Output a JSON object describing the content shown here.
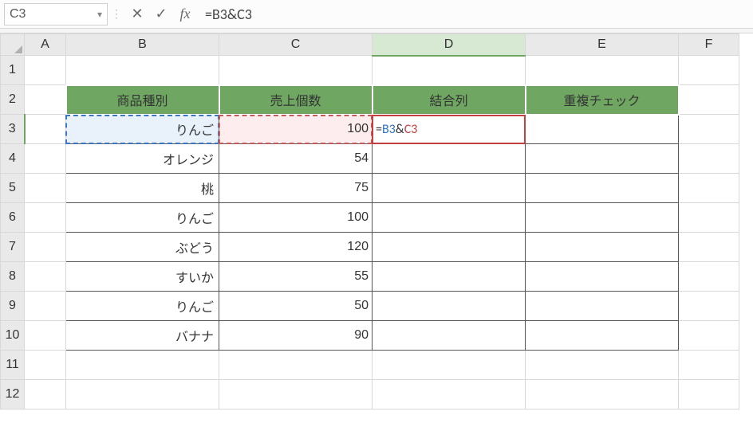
{
  "name_box": "C3",
  "formula_text": "=B3&C3",
  "columns": [
    "A",
    "B",
    "C",
    "D",
    "E",
    "F"
  ],
  "rows": [
    "1",
    "2",
    "3",
    "4",
    "5",
    "6",
    "7",
    "8",
    "9",
    "10",
    "11",
    "12"
  ],
  "headers": {
    "B": "商品種別",
    "C": "売上個数",
    "D": "結合列",
    "E": "重複チェック"
  },
  "data": [
    {
      "b": "りんご",
      "c": "100"
    },
    {
      "b": "オレンジ",
      "c": "54"
    },
    {
      "b": "桃",
      "c": "75"
    },
    {
      "b": "りんご",
      "c": "100"
    },
    {
      "b": "ぶどう",
      "c": "120"
    },
    {
      "b": "すいか",
      "c": "55"
    },
    {
      "b": "りんご",
      "c": "50"
    },
    {
      "b": "バナナ",
      "c": "90"
    }
  ],
  "editing_cell": {
    "ref_b": "B3",
    "amp": "&",
    "ref_c": "C3",
    "eq": "="
  },
  "icons": {
    "cancel": "✕",
    "enter": "✓",
    "fx": "fx",
    "dropdown": "▾",
    "sep": "⋮"
  },
  "chart_data": {
    "type": "table",
    "title": "",
    "columns": [
      "商品種別",
      "売上個数",
      "結合列",
      "重複チェック"
    ],
    "rows": [
      [
        "りんご",
        100,
        "",
        ""
      ],
      [
        "オレンジ",
        54,
        "",
        ""
      ],
      [
        "桃",
        75,
        "",
        ""
      ],
      [
        "りんご",
        100,
        "",
        ""
      ],
      [
        "ぶどう",
        120,
        "",
        ""
      ],
      [
        "すいか",
        55,
        "",
        ""
      ],
      [
        "りんご",
        50,
        "",
        ""
      ],
      [
        "バナナ",
        90,
        "",
        ""
      ]
    ],
    "active_formula": "=B3&C3",
    "active_cell": "D3"
  }
}
